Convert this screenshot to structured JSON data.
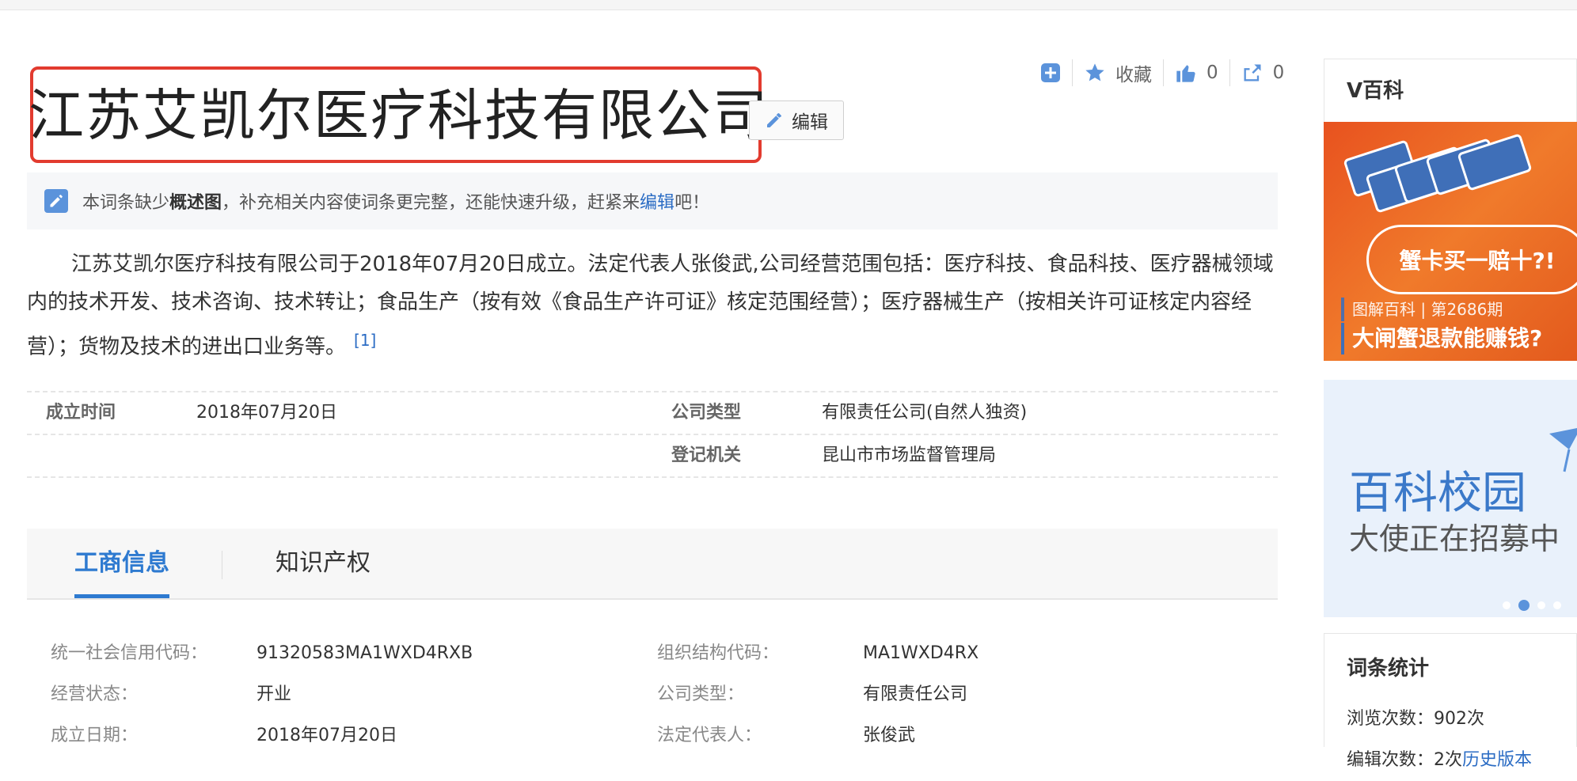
{
  "page": {
    "title": "江苏艾凯尔医疗科技有限公司",
    "edit_label": "编辑"
  },
  "actions": {
    "favorite_label": "收藏",
    "like_count": "0",
    "share_count": "0"
  },
  "tip": {
    "prefix": "本词条缺少",
    "missing": "概述图",
    "middle": "，补充相关内容使词条更完整，还能快速升级，赶紧来",
    "link": "编辑",
    "suffix": "吧！"
  },
  "summary": {
    "text": "江苏艾凯尔医疗科技有限公司于2018年07月20日成立。法定代表人张俊武,公司经营范围包括：医疗科技、食品科技、医疗器械领域内的技术开发、技术咨询、技术转让；食品生产（按有效《食品生产许可证》核定范围经营）；医疗器械生产（按相关许可证核定内容经营）；货物及技术的进出口业务等。",
    "ref": "[1]"
  },
  "basic_info": {
    "rows": [
      {
        "k1": "成立时间",
        "v1": "2018年07月20日",
        "k2": "公司类型",
        "v2": "有限责任公司(自然人独资)"
      },
      {
        "k1": "",
        "v1": "",
        "k2": "登记机关",
        "v2": "昆山市市场监督管理局"
      }
    ]
  },
  "tabs": [
    {
      "label": "工商信息",
      "active": true
    },
    {
      "label": "知识产权",
      "active": false
    }
  ],
  "business": {
    "rows": [
      {
        "k1": "统一社会信用代码：",
        "v1": "91320583MA1WXD4RXB",
        "k2": "组织结构代码：",
        "v2": "MA1WXD4RX"
      },
      {
        "k1": "经营状态：",
        "v1": "开业",
        "k2": "公司类型：",
        "v2": "有限责任公司"
      },
      {
        "k1": "成立日期：",
        "v1": "2018年07月20日",
        "k2": "法定代表人：",
        "v2": "张俊武"
      }
    ]
  },
  "sidebar": {
    "vbaike_title": "V百科",
    "promo1_bubble": "蟹卡买一赔十?!",
    "promo1_sub": "图解百科 | 第2686期",
    "promo1_big": "大闸蟹退款能赚钱?",
    "promo2_title": "百科校园",
    "promo2_sub": "大使正在招募中",
    "stats_title": "词条统计",
    "views_label": "浏览次数：902次",
    "edits_label": "编辑次数：",
    "edits_value": "2次",
    "history_link": "历史版本"
  },
  "colors": {
    "accent": "#2e7ad0",
    "highlight_border": "#e23b2f",
    "link": "#2b6cc4"
  }
}
